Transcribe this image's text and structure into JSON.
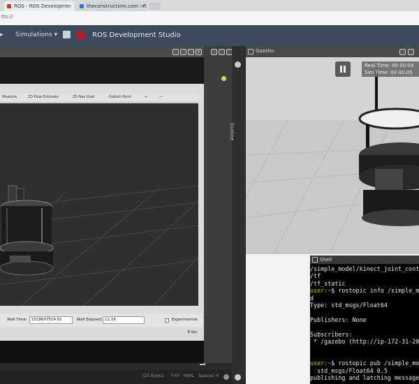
{
  "browser": {
    "tabs": [
      {
        "label": "ROS - ROS Developme",
        "close": "×",
        "fav": "#c0392b"
      },
      {
        "label": "theconstructsim.com - ROS",
        "close": "×",
        "fav": "#3b6fd1"
      }
    ],
    "address": "tts://"
  },
  "app": {
    "menu_simulations": "Simulations ▾",
    "title": "ROS Development Studio"
  },
  "rviz": {
    "toolbar": [
      "Measure",
      "2D Pose Estimate",
      "2D Nav Goal",
      "Publish Point",
      "+",
      "—"
    ],
    "wall_time_label": "Wall Time:",
    "wall_time_value": "1518607514.81",
    "wall_elapsed_label": "Wall Elapsed:",
    "wall_elapsed_value": "11.18",
    "experimental_label": "Experimental",
    "fps": "8 fps"
  },
  "outline": {
    "label": "Outline"
  },
  "gazebo": {
    "title": "Gazebo",
    "real_time": "Real Time: 00 00:04",
    "sim_time": "Sim Time: 00 00:05"
  },
  "shell": {
    "title": "Shell",
    "lines": [
      {
        "text": "/simple_model/kinect_joint_cont",
        "prompt": ""
      },
      {
        "text": "/tf",
        "prompt": ""
      },
      {
        "text": "/tf_static",
        "prompt": ""
      },
      {
        "text": "$ rostopic info /simple_mo",
        "prompt": "user:~"
      },
      {
        "text": "d",
        "prompt": ""
      },
      {
        "text": "Type: std_msgs/Float64",
        "prompt": ""
      },
      {
        "text": "",
        "prompt": ""
      },
      {
        "text": "Publishers: None",
        "prompt": ""
      },
      {
        "text": "",
        "prompt": ""
      },
      {
        "text": "Subscribers:",
        "prompt": ""
      },
      {
        "text": " * /gazebo (http://ip-172-31-20",
        "prompt": ""
      },
      {
        "text": "",
        "prompt": ""
      },
      {
        "text": "",
        "prompt": ""
      },
      {
        "text": "$ rostopic pub /simple_mod",
        "prompt": "user:~"
      },
      {
        "text": "  std_msgs/Float64 0.5",
        "prompt": ""
      },
      {
        "text": "publishing and latching message",
        "prompt": ""
      }
    ]
  },
  "editor_status": {
    "bytes": "(25 Bytes)",
    "position": "7:67",
    "mode": "YAML",
    "spaces": "Spaces: 4"
  }
}
